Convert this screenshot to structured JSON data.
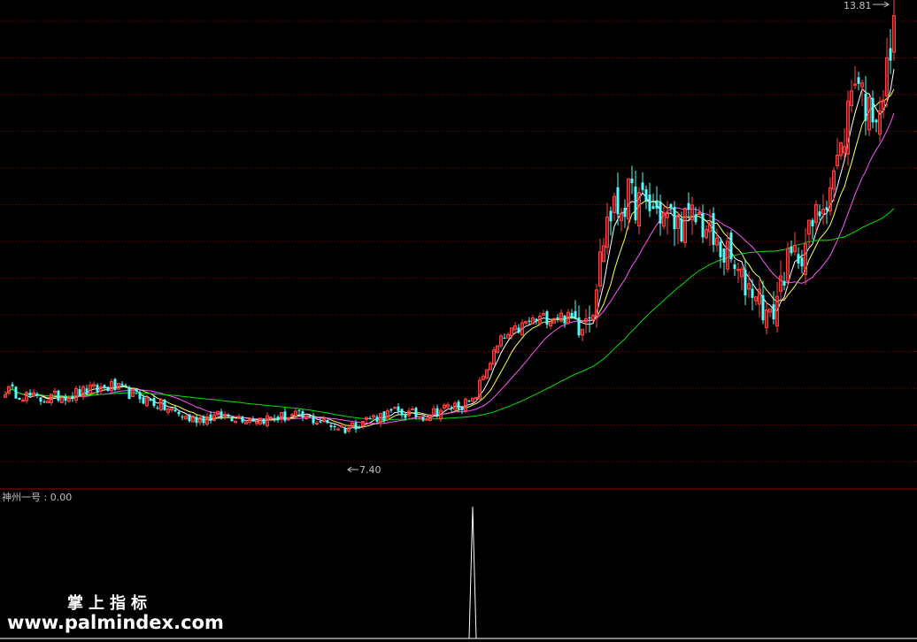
{
  "chart_data": {
    "type": "candlestick",
    "price_range": [
      6.6,
      13.9
    ],
    "annotations": {
      "high_label": "13.81",
      "low_label": "7.40"
    },
    "indicator": {
      "label": "神州一号 : 0.00",
      "range": [
        0,
        1
      ],
      "spike_index": 132,
      "spike_value": 1
    },
    "watermark": {
      "line1": "掌上指标",
      "line2": "www.palmindex.com"
    },
    "colors": {
      "background": "#000000",
      "grid": "#8b0000",
      "up": "#ff4040",
      "down": "#54fcfc",
      "ma_short": "#ffffff",
      "ma_mid": "#ffff55",
      "ma_long": "#ff55ff",
      "ma_longest": "#00e000",
      "indicator_line": "#ffffff",
      "divider": "#a00000"
    },
    "ohlc_anchors": [
      [
        0,
        7.95
      ],
      [
        10,
        7.8
      ],
      [
        20,
        7.9
      ],
      [
        30,
        8.0
      ],
      [
        42,
        7.75
      ],
      [
        52,
        7.5
      ],
      [
        62,
        7.55
      ],
      [
        72,
        7.5
      ],
      [
        82,
        7.55
      ],
      [
        90,
        7.45
      ],
      [
        96,
        7.35
      ],
      [
        102,
        7.5
      ],
      [
        110,
        7.6
      ],
      [
        118,
        7.55
      ],
      [
        126,
        7.7
      ],
      [
        132,
        7.75
      ],
      [
        136,
        8.3
      ],
      [
        140,
        8.7
      ],
      [
        148,
        9.0
      ],
      [
        156,
        9.1
      ],
      [
        162,
        9.0
      ],
      [
        166,
        9.3
      ],
      [
        170,
        10.6
      ],
      [
        176,
        10.9
      ],
      [
        184,
        10.7
      ],
      [
        190,
        10.5
      ],
      [
        196,
        10.6
      ],
      [
        200,
        10.2
      ],
      [
        204,
        10.0
      ],
      [
        208,
        9.6
      ],
      [
        212,
        9.5
      ],
      [
        216,
        9.0
      ],
      [
        220,
        9.8
      ],
      [
        226,
        10.2
      ],
      [
        232,
        11.0
      ],
      [
        236,
        11.6
      ],
      [
        240,
        12.9
      ],
      [
        244,
        12.2
      ],
      [
        248,
        12.5
      ],
      [
        251,
        13.45
      ]
    ]
  }
}
